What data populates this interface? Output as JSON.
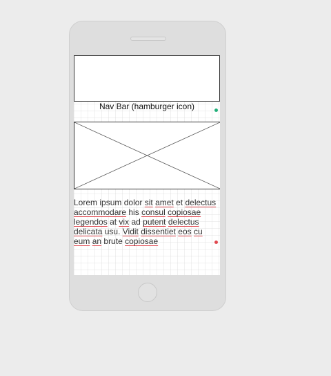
{
  "mockup": {
    "nav_label": "Nav Bar (hamburger icon)",
    "image_placeholder_icon": "image-placeholder-x",
    "paragraph": {
      "w1": "Lorem",
      "w2": "ipsum",
      "w3": "dolor",
      "w4": "sit",
      "w5": "amet",
      "w6": "et",
      "w7": "delectus",
      "w8": "accommodare",
      "w9": "his",
      "w10": "consul",
      "w11": "copiosae",
      "w12": "legendos",
      "w13": "at",
      "w14": "vix",
      "w15": "ad",
      "w16": "putent",
      "w17": "delectus",
      "w18": "delicata",
      "w19": "usu.",
      "w20": "Vidit",
      "w21": "dissentiet",
      "w22": "eos",
      "w23": "cu",
      "w24": "eum",
      "w25": "an",
      "w26": "brute",
      "w27": "copiosae"
    },
    "colors": {
      "selection_dot_top": "#22b07a",
      "selection_dot_bottom": "#e0484f",
      "spellcheck_underline": "#e0484f",
      "phone_body": "#dedede",
      "background": "#ececec"
    }
  }
}
